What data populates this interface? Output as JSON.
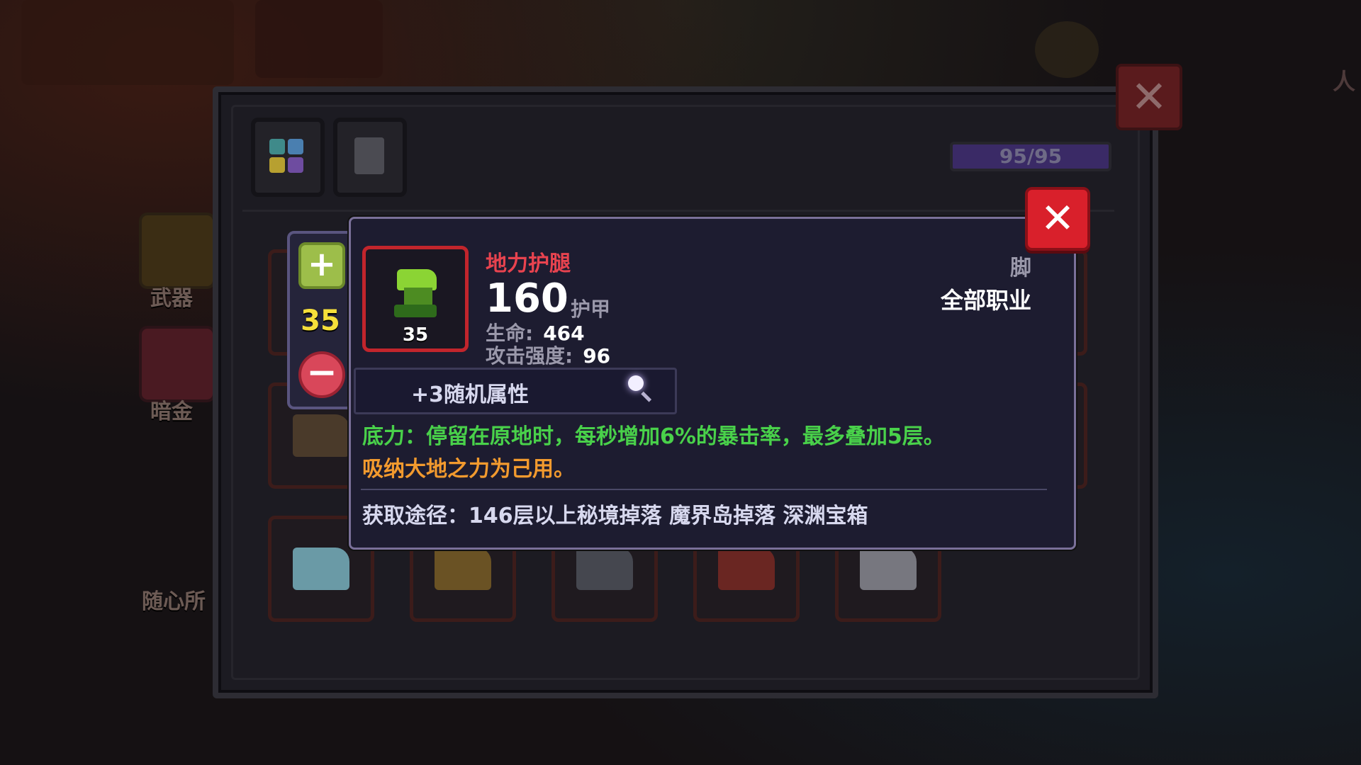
{
  "side_menu": {
    "weapon_label": "武器",
    "dark_gold_label": "暗金",
    "free_label": "随心所"
  },
  "background_text": {
    "top_right": "人"
  },
  "panel": {
    "capacity_text": "95/95",
    "close_icon": "close-icon"
  },
  "level_selector": {
    "plus_symbol": "+",
    "level": "35",
    "minus_symbol": "−"
  },
  "item": {
    "name": "地力护腿",
    "item_level": "35",
    "armor_value": "160",
    "armor_label": "护甲",
    "stats": [
      {
        "key": "生命:",
        "value": "464"
      },
      {
        "key": "攻击强度:",
        "value": "96"
      }
    ],
    "slot_type": "脚",
    "class_type": "全部职业",
    "random_attr_label": "+3随机属性",
    "skill_text": "底力：停留在原地时，每秒增加6%的暴击率，最多叠加5层。",
    "flavor_text": "吸纳大地之力为己用。",
    "source_text": "获取途径：146层以上秘境掉落 魔界岛掉落 深渊宝箱",
    "name_color": "#e8434f",
    "skill_color": "#49d14a",
    "flavor_color": "#f29a2e"
  },
  "card_close": {
    "symbol": "✕"
  },
  "panel_close": {
    "symbol": "✕"
  }
}
